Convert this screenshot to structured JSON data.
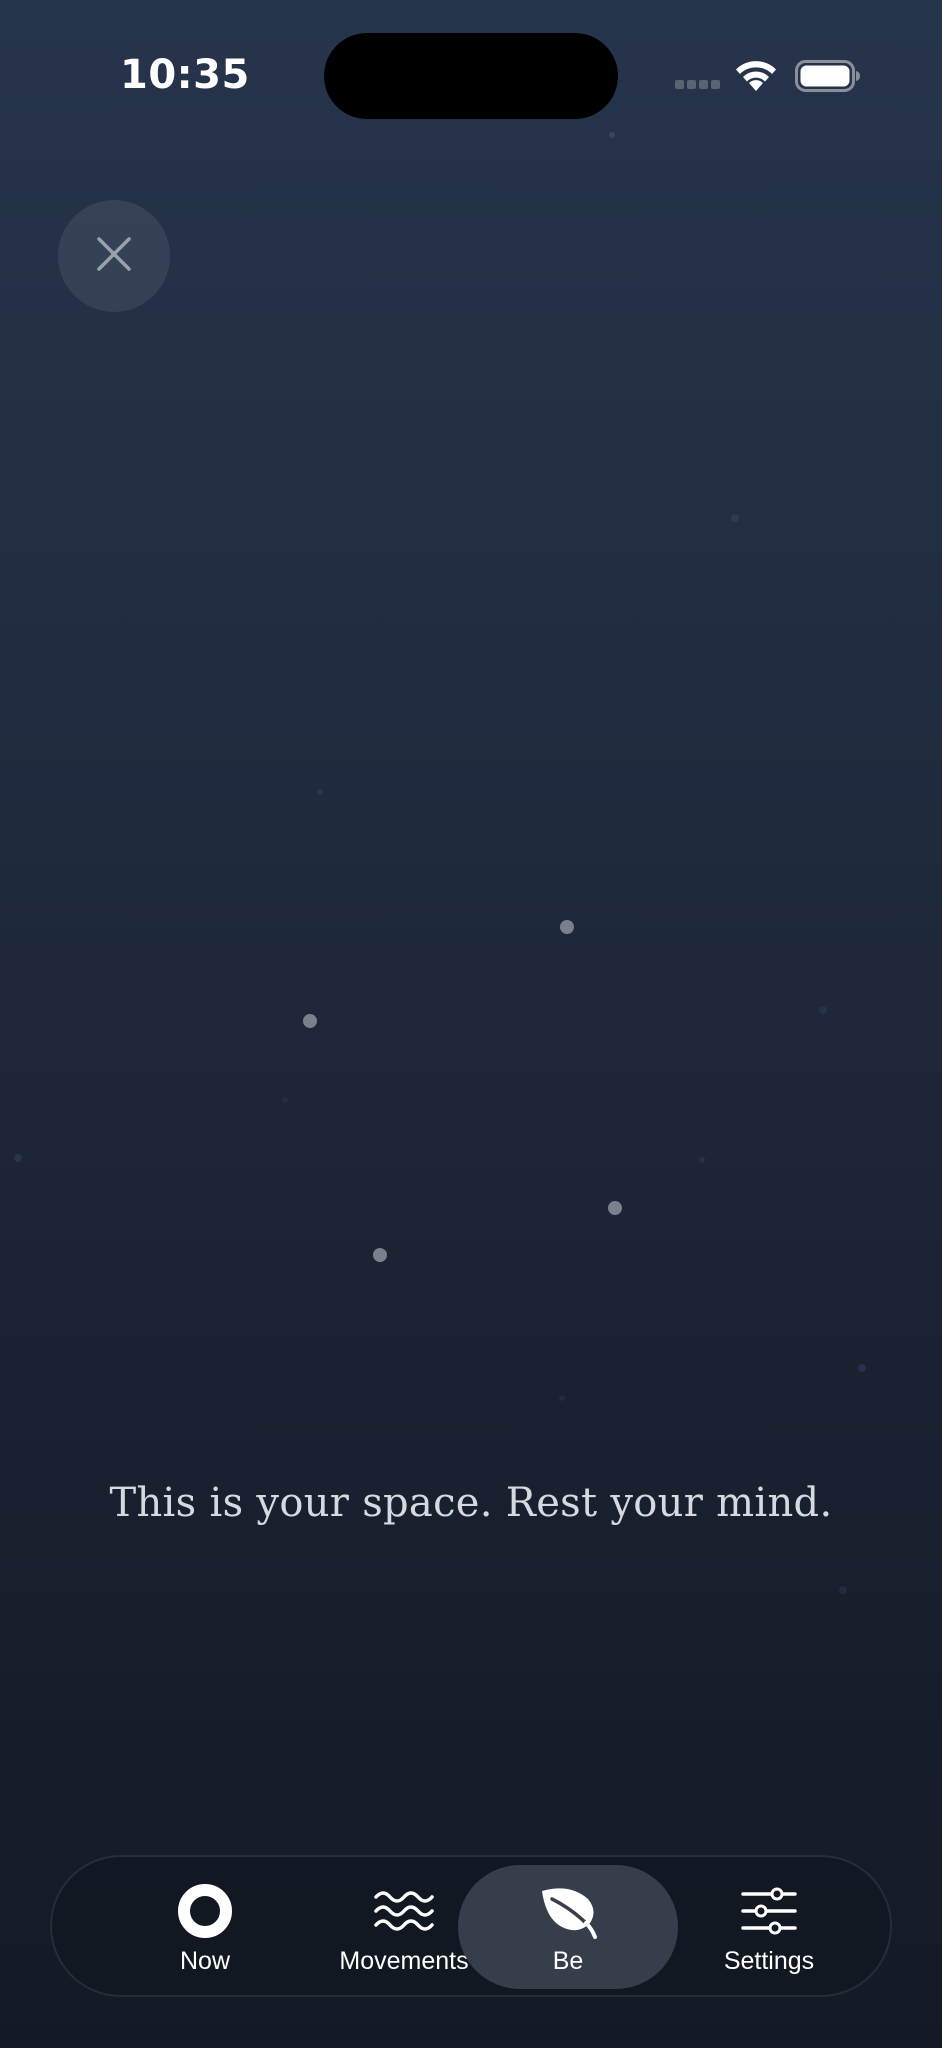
{
  "status_bar": {
    "time": "10:35"
  },
  "close_button": {
    "icon": "close-icon"
  },
  "message": "This is your space. Rest your mind.",
  "tab_bar": {
    "tabs": [
      {
        "label": "Now",
        "icon": "ring-icon",
        "active": false
      },
      {
        "label": "Movements",
        "icon": "waves-icon",
        "active": false
      },
      {
        "label": "Be",
        "icon": "leaf-icon",
        "active": true
      },
      {
        "label": "Settings",
        "icon": "sliders-icon",
        "active": false
      }
    ]
  },
  "colors": {
    "background_top": "#26344c",
    "background_bottom": "#141a25",
    "active_tab": "#353e4a",
    "text": "#d6d9de"
  }
}
